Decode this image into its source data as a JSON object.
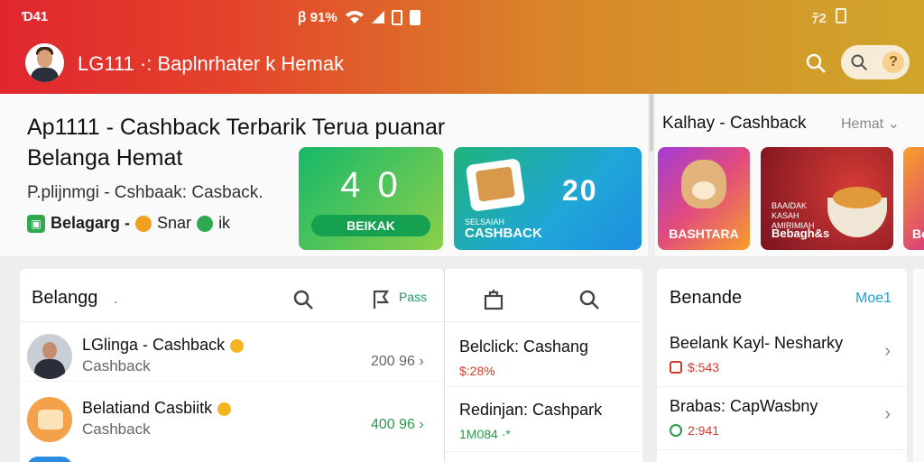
{
  "status": {
    "time": "Ɗ41",
    "carrier": "ꞵ 91%",
    "right": "ﾃ2"
  },
  "header": {
    "title": "LG111 ·: Baplnrhater k Hemak"
  },
  "hero": {
    "headline": "Ap1111 - Cashback Terbarik Terua puanar Belanga Hemat",
    "subtitle": "P.plijnmgi - Cshbaak: Casback.",
    "meta_label": "Belagarg -",
    "meta_extra": "Snar",
    "meta_extra2": "ik",
    "card1": {
      "value": "4 0",
      "button": "BEIKAK"
    },
    "card2": {
      "value": "20",
      "small": "SELSAIAH",
      "label": "CASHBACK"
    }
  },
  "side": {
    "title": "Kalhay - Cashback",
    "more": "Hemat ⌄",
    "cards": [
      {
        "label": "BASHTARA"
      },
      {
        "tiny": "BAAIDAK\nKASAH\nAMIRIMIAH",
        "label": "Bebagh&s"
      },
      {
        "label": "Be"
      }
    ]
  },
  "panel1": {
    "title": "Belangg",
    "dot": "·",
    "pass": "Pass",
    "rows": [
      {
        "name": "LGlinga - Cashback",
        "desc": "Cashback",
        "amount": "200 96 ›"
      },
      {
        "name": "Belatiand Casbiitk",
        "desc": "Cashback",
        "amount": "400 96 ›"
      }
    ]
  },
  "panel2": {
    "items": [
      {
        "name": "Belclick: Cashang",
        "value": "$:28%"
      },
      {
        "name": "Redinjan: Cashpark",
        "value": "1M084 ·*"
      }
    ]
  },
  "panel3": {
    "title": "Benande",
    "more": "Moe1",
    "items": [
      {
        "name": "Beelank Kayl- Nesharky",
        "value": "$:543"
      },
      {
        "name": "Brabas: CapWasbny",
        "value": "2:941"
      }
    ]
  },
  "colors": {
    "header_start": "#e0262e",
    "header_end": "#cfa62a",
    "accent_green": "#2a9a4a",
    "accent_red": "#d23c2a"
  }
}
